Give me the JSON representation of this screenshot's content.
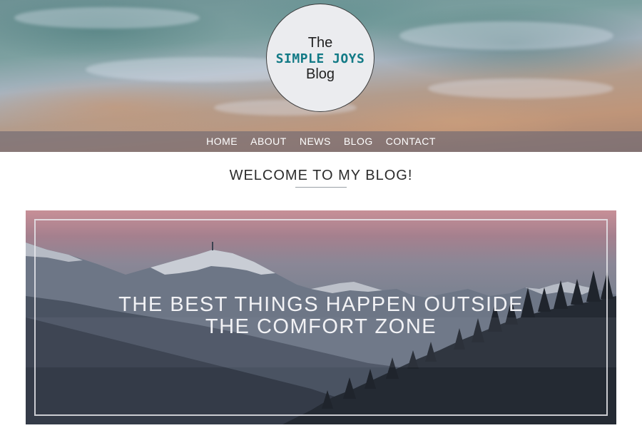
{
  "logo": {
    "line1": "The",
    "line2": "SIMPLE JOYS",
    "line3": "Blog"
  },
  "nav": {
    "items": [
      "HOME",
      "ABOUT",
      "NEWS",
      "BLOG",
      "CONTACT"
    ]
  },
  "welcome": {
    "title": "WELCOME TO MY BLOG!"
  },
  "banner": {
    "line1": "THE BEST THINGS HAPPEN OUTSIDE",
    "line2": "THE COMFORT ZONE"
  },
  "colors": {
    "logo_accent": "#127a86",
    "nav_background": "rgba(110,105,115,0.65)",
    "banner_sky_top": "#c78f97"
  }
}
